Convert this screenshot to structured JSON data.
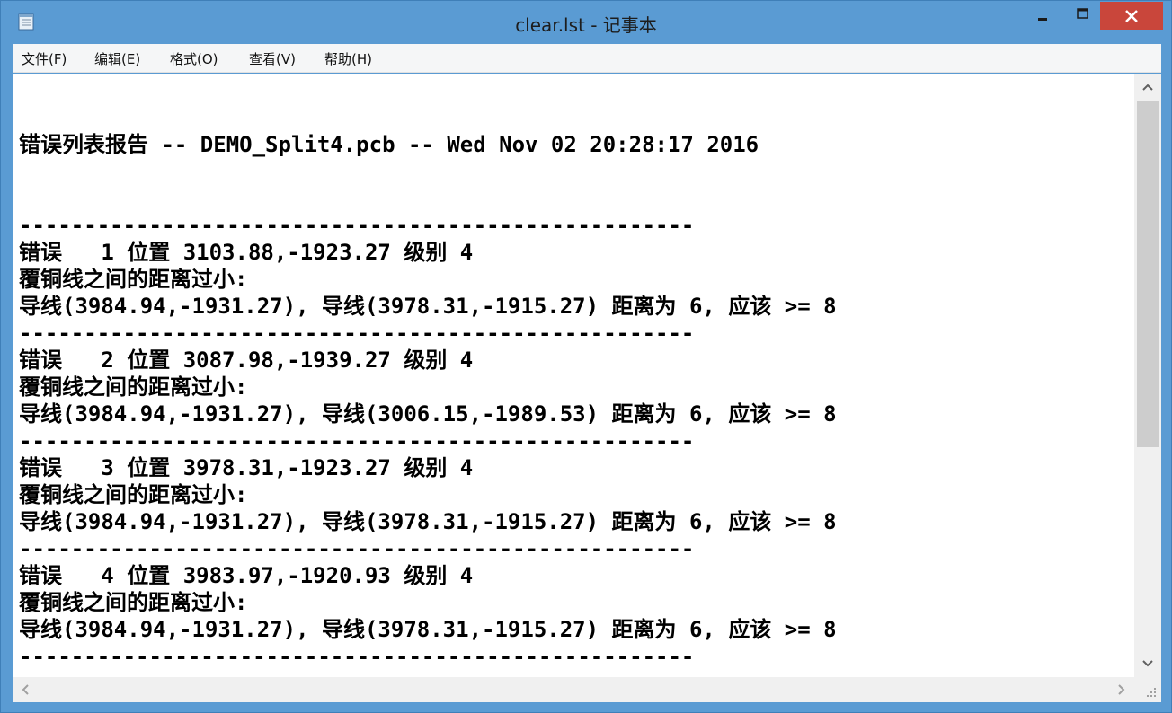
{
  "window": {
    "title": "clear.lst - 记事本"
  },
  "menu": {
    "items": [
      {
        "label": "文件(F)"
      },
      {
        "label": "编辑(E)"
      },
      {
        "label": "格式(O)"
      },
      {
        "label": "查看(V)"
      },
      {
        "label": "帮助(H)"
      }
    ]
  },
  "document": {
    "header": "错误列表报告 -- DEMO_Split4.pcb -- Wed Nov 02 20:28:17 2016",
    "separator": "----------------------------------------------------",
    "errors": [
      {
        "line1": "错误   1 位置 3103.88,-1923.27 级别 4",
        "line2": "覆铜线之间的距离过小:",
        "line3": "导线(3984.94,-1931.27), 导线(3978.31,-1915.27) 距离为 6, 应该 >= 8"
      },
      {
        "line1": "错误   2 位置 3087.98,-1939.27 级别 4",
        "line2": "覆铜线之间的距离过小:",
        "line3": "导线(3984.94,-1931.27), 导线(3006.15,-1989.53) 距离为 6, 应该 >= 8"
      },
      {
        "line1": "错误   3 位置 3978.31,-1923.27 级别 4",
        "line2": "覆铜线之间的距离过小:",
        "line3": "导线(3984.94,-1931.27), 导线(3978.31,-1915.27) 距离为 6, 应该 >= 8"
      },
      {
        "line1": "错误   4 位置 3983.97,-1920.93 级别 4",
        "line2": "覆铜线之间的距离过小:",
        "line3": "导线(3984.94,-1931.27), 导线(3978.31,-1915.27) 距离为 6, 应该 >= 8"
      }
    ]
  },
  "colors": {
    "title_bar": "#5a9bd3",
    "close_button": "#c9463b",
    "menu_bar": "#f5f6f7",
    "edit_background": "#ffffff",
    "scrollbar_track": "#f0f0f0",
    "scrollbar_thumb": "#cdcdcd"
  },
  "icons": {
    "app": "notepad-icon",
    "minimize": "minimize-icon",
    "maximize": "maximize-icon",
    "close": "close-icon",
    "scroll_up": "chevron-up-icon",
    "scroll_down": "chevron-down-icon",
    "scroll_left": "chevron-left-icon",
    "scroll_right": "chevron-right-icon",
    "grip": "size-grip-icon"
  }
}
